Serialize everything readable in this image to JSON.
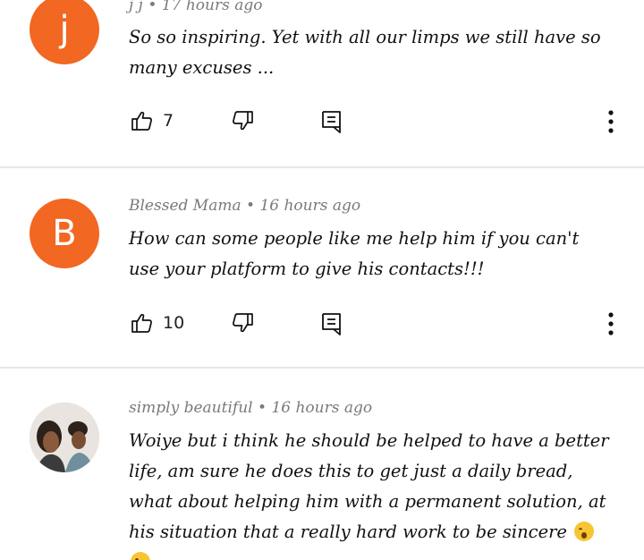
{
  "comments": [
    {
      "author": "j j",
      "time": "17 hours ago",
      "avatar_letter": "j",
      "avatar_color": "#f26722",
      "text": "So so inspiring. Yet with all our limps we still have so many excuses ...",
      "likes": "7"
    },
    {
      "author": "Blessed Mama",
      "time": "16 hours ago",
      "avatar_letter": "B",
      "avatar_color": "#f26722",
      "text": "How can some people like me help him if you can't use your platform to give his contacts!!!",
      "likes": "10"
    },
    {
      "author": "simply beautiful",
      "time": "16 hours ago",
      "avatar_letter": "",
      "text": "Woiye but i think he should  be helped to have a better life, am sure he does this to get just a daily bread, what about helping him with a permanent solution, at his situation that a really hard work to be sincere",
      "text_suffix": "."
    }
  ],
  "separator": " • ",
  "icons": {
    "like": "thumb-up-icon",
    "dislike": "thumb-down-icon",
    "reply": "reply-icon",
    "more": "more-vertical-icon"
  }
}
